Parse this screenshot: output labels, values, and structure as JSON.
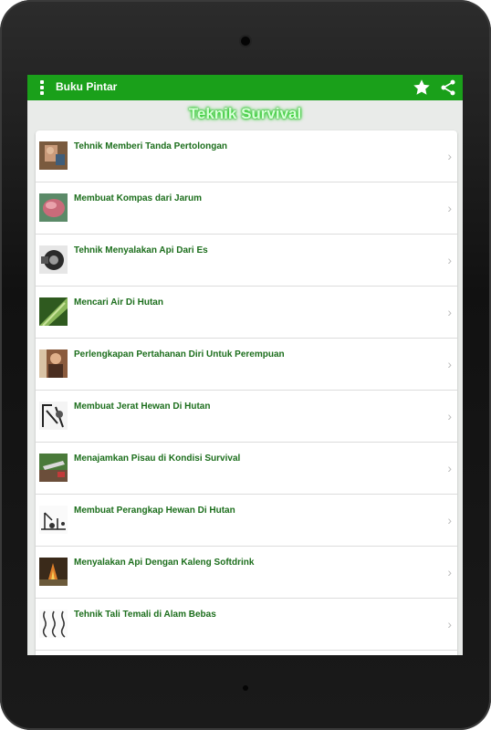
{
  "app": {
    "title": "Buku Pintar"
  },
  "page": {
    "title": "Teknik Survival"
  },
  "icons": {
    "menu": "overflow-dots-icon",
    "favorite": "star-icon",
    "share": "share-icon",
    "chevron": "chevron-right-icon"
  },
  "colors": {
    "appbar": "#1aa01a",
    "title_glow": "#2bd42b",
    "item_text": "#1c6e1c"
  },
  "list": {
    "items": [
      {
        "label": "Tehnik Memberi Tanda Pertolongan"
      },
      {
        "label": "Membuat Kompas dari Jarum"
      },
      {
        "label": "Tehnik Menyalakan Api Dari Es"
      },
      {
        "label": "Mencari Air Di Hutan"
      },
      {
        "label": "Perlengkapan Pertahanan Diri Untuk Perempuan"
      },
      {
        "label": "Membuat Jerat Hewan Di Hutan"
      },
      {
        "label": "Menajamkan Pisau di Kondisi Survival"
      },
      {
        "label": "Membuat Perangkap Hewan Di Hutan"
      },
      {
        "label": "Menyalakan Api Dengan Kaleng Softdrink"
      },
      {
        "label": "Tehnik Tali Temali di Alam Bebas"
      }
    ]
  }
}
